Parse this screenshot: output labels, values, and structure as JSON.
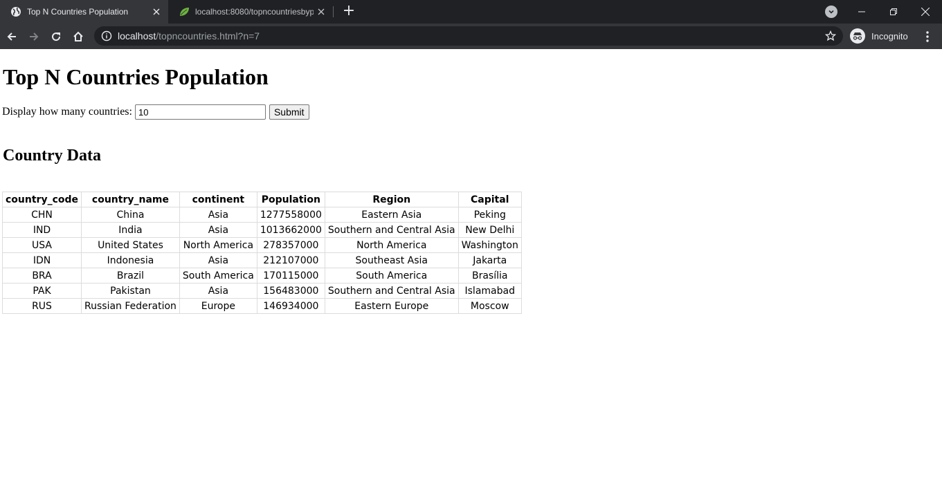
{
  "browser": {
    "tabs": [
      {
        "title": "Top N Countries Population",
        "active": true,
        "icon": "globe-icon"
      },
      {
        "title": "localhost:8080/topncountriesbyp",
        "active": false,
        "icon": "spring-leaf-icon"
      }
    ],
    "address": {
      "host": "localhost",
      "path": "/topncountries.html?n=7"
    },
    "incognito_label": "Incognito",
    "colors": {
      "tabstrip": "#202124",
      "toolbar": "#35363a",
      "omnibox": "#202124"
    }
  },
  "page": {
    "title": "Top N Countries Population",
    "form": {
      "label": "Display how many countries:",
      "value": "10",
      "submit_label": "Submit"
    },
    "section_title": "Country Data",
    "table": {
      "headers": [
        "country_code",
        "country_name",
        "continent",
        "Population",
        "Region",
        "Capital"
      ],
      "rows": [
        [
          "CHN",
          "China",
          "Asia",
          "1277558000",
          "Eastern Asia",
          "Peking"
        ],
        [
          "IND",
          "India",
          "Asia",
          "1013662000",
          "Southern and Central Asia",
          "New Delhi"
        ],
        [
          "USA",
          "United States",
          "North America",
          "278357000",
          "North America",
          "Washington"
        ],
        [
          "IDN",
          "Indonesia",
          "Asia",
          "212107000",
          "Southeast Asia",
          "Jakarta"
        ],
        [
          "BRA",
          "Brazil",
          "South America",
          "170115000",
          "South America",
          "Brasília"
        ],
        [
          "PAK",
          "Pakistan",
          "Asia",
          "156483000",
          "Southern and Central Asia",
          "Islamabad"
        ],
        [
          "RUS",
          "Russian Federation",
          "Europe",
          "146934000",
          "Eastern Europe",
          "Moscow"
        ]
      ]
    }
  }
}
